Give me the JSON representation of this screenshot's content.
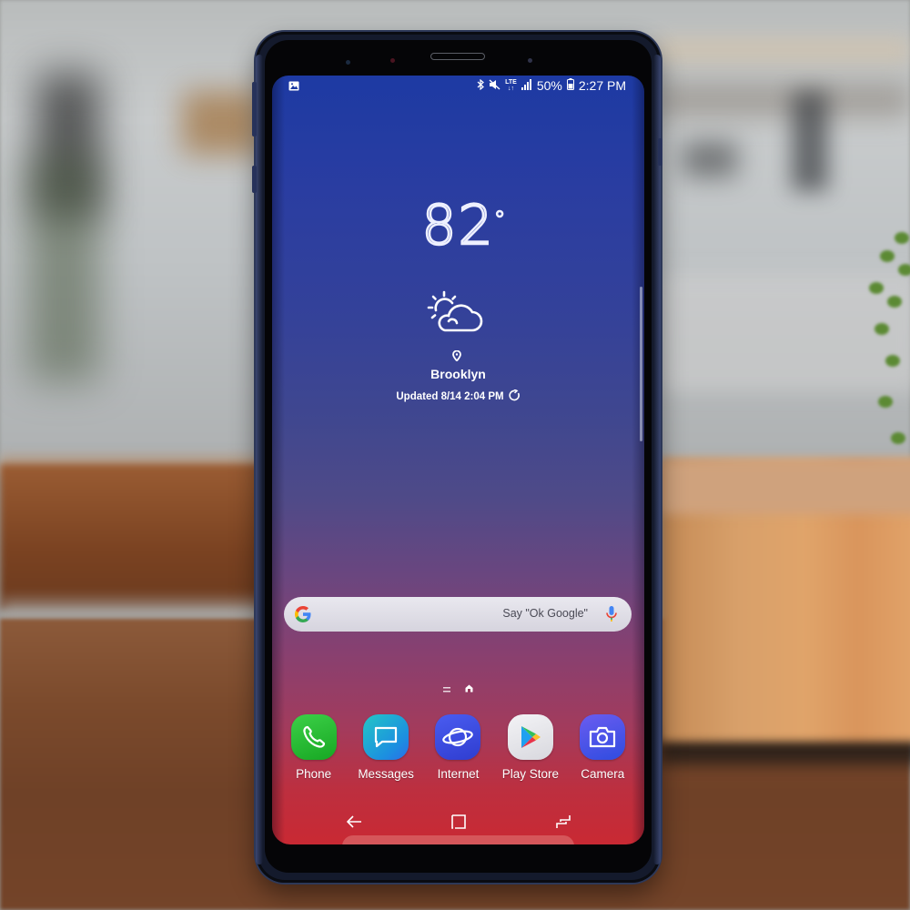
{
  "scene": {
    "description": "Photo of a Samsung Galaxy smartphone standing on a wooden table showing its home screen"
  },
  "status_bar": {
    "left_icon": "gallery-notification-icon",
    "icons": [
      "bluetooth-icon",
      "mute-icon",
      "lte-icon",
      "signal-icon",
      "battery-icon"
    ],
    "lte_label": "LTE",
    "battery": "50%",
    "time": "2:27 PM"
  },
  "weather": {
    "temperature": "82",
    "degree_symbol": "°",
    "condition_icon": "partly-sunny-icon",
    "location": "Brooklyn",
    "updated": "Updated 8/14 2:04 PM",
    "refresh_icon": "refresh-icon"
  },
  "search": {
    "logo": "google-g-icon",
    "hint": "Say \"Ok Google\"",
    "mic_icon": "mic-icon"
  },
  "page_indicator": {
    "items": [
      "menu-page",
      "home-page"
    ],
    "active": "home-page"
  },
  "dock": {
    "apps": [
      {
        "label": "Phone",
        "icon": "phone-icon",
        "color": "#22b02c"
      },
      {
        "label": "Messages",
        "icon": "messages-icon",
        "color": "#1fa6d8"
      },
      {
        "label": "Internet",
        "icon": "internet-icon",
        "color": "#3a4fe0"
      },
      {
        "label": "Play Store",
        "icon": "play-store-icon",
        "color": "#e8e8ec"
      },
      {
        "label": "Camera",
        "icon": "camera-icon",
        "color": "#4a53e0"
      }
    ]
  },
  "nav_bar": {
    "buttons": [
      "back",
      "home",
      "recents"
    ]
  }
}
